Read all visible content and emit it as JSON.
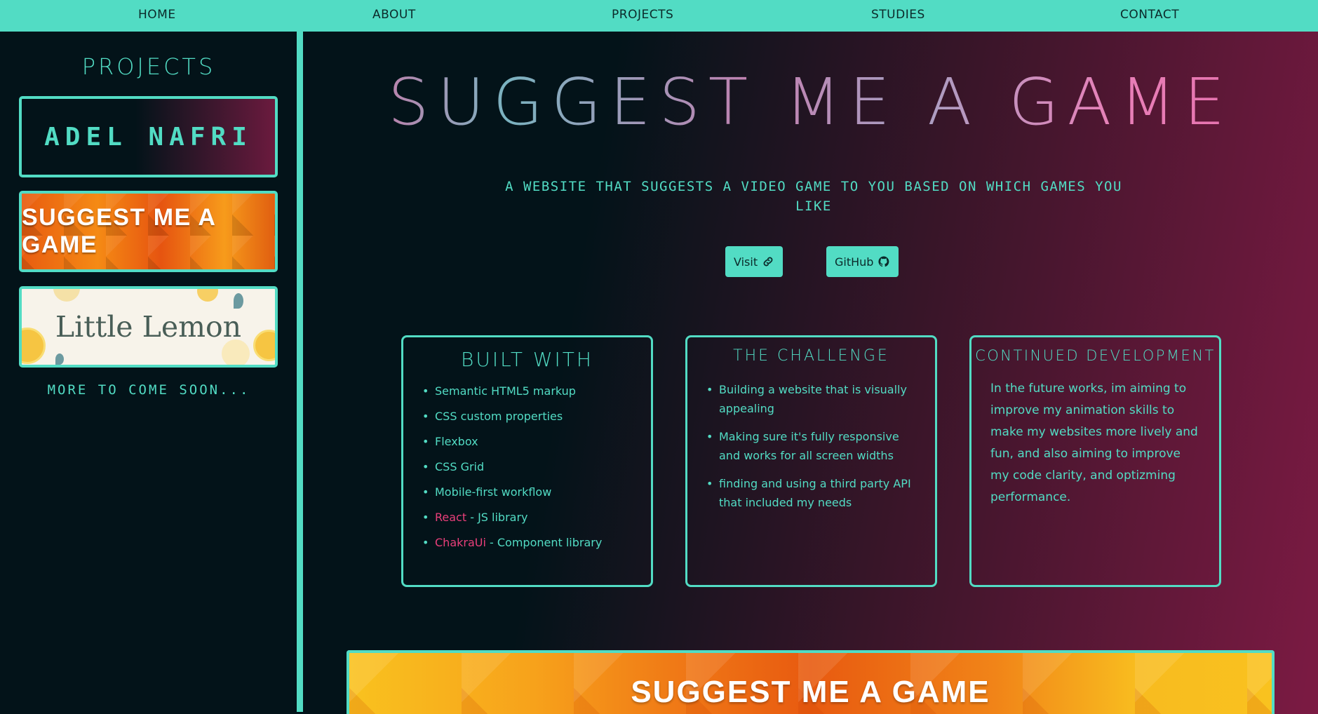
{
  "nav": {
    "items": [
      "HOME",
      "ABOUT",
      "PROJECTS",
      "STUDIES",
      "CONTACT"
    ]
  },
  "sidebar": {
    "title": "PROJECTS",
    "cards": [
      "ADEL NAFRI",
      "SUGGEST ME A GAME",
      "Little Lemon"
    ],
    "more": "MORE TO COME SOON..."
  },
  "project": {
    "title": "SUGGEST ME A GAME",
    "description": "A WEBSITE THAT SUGGESTS A VIDEO GAME TO YOU BASED ON WHICH GAMES YOU LIKE",
    "buttons": {
      "visit": "Visit",
      "github": "GitHub"
    },
    "built_with": {
      "heading": "BUILT WITH",
      "items": [
        {
          "highlight": "",
          "text": "Semantic HTML5 markup"
        },
        {
          "highlight": "",
          "text": "CSS custom properties"
        },
        {
          "highlight": "",
          "text": "Flexbox"
        },
        {
          "highlight": "",
          "text": "CSS Grid"
        },
        {
          "highlight": "",
          "text": "Mobile-first workflow"
        },
        {
          "highlight": "React",
          "text": " - JS library"
        },
        {
          "highlight": "ChakraUi",
          "text": " - Component library"
        }
      ]
    },
    "challenge": {
      "heading": "THE CHALLENGE",
      "items": [
        "Building a website that is visually appealing",
        "Making sure it's fully responsive and works for all screen widths",
        "finding and using a third party API that included my needs"
      ]
    },
    "continued": {
      "heading": "CONTINUED DEVELOPMENT",
      "text": "In the future works, im aiming to improve my animation skills to make my websites more lively and fun, and also aiming to improve my code clarity, and optizming performance."
    },
    "banner": "SUGGEST ME A GAME"
  },
  "colors": {
    "accent": "#52dcc4",
    "background": "#031319",
    "gradient_end": "#7c1a43",
    "highlight": "#e93f7a"
  },
  "icons": {
    "visit": "link-icon",
    "github": "github-icon"
  }
}
